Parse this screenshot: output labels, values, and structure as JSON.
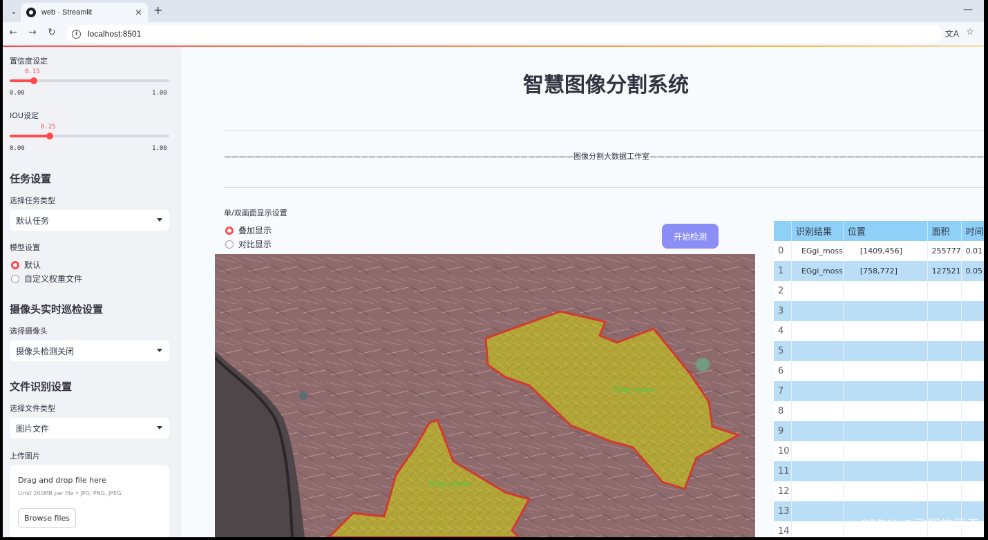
{
  "browser": {
    "tab_title": "web · Streamlit",
    "url": "localhost:8501"
  },
  "sidebar": {
    "confidence": {
      "label": "置信度设定",
      "value": "0.15",
      "value_fraction": 0.15,
      "min": "0.00",
      "max": "1.00"
    },
    "iou": {
      "label": "IOU设定",
      "value": "0.25",
      "value_fraction": 0.25,
      "min": "0.00",
      "max": "1.00"
    },
    "task_heading": "任务设置",
    "task_type_label": "选择任务类型",
    "task_type_value": "默认任务",
    "model_label": "模型设置",
    "model_options": [
      "默认",
      "自定义权重文件"
    ],
    "model_selected": "默认",
    "camera_heading": "摄像头实时巡检设置",
    "camera_label": "选择摄像头",
    "camera_value": "摄像头检测关闭",
    "file_heading": "文件识别设置",
    "file_type_label": "选择文件类型",
    "file_type_value": "图片文件",
    "upload_label": "上传图片",
    "dropzone_title": "Drag and drop file here",
    "dropzone_limit": "Limit 200MB per file • JPG, PNG, JPEG",
    "browse_label": "Browse files"
  },
  "main": {
    "title": "智慧图像分割系统",
    "studio_line": "——————————————————————————————————————————————图像分割大数据工作室——————————————————————————————————————————————————",
    "display_label": "单/双画面显示设置",
    "display_options": [
      "叠加显示",
      "对比显示"
    ],
    "display_selected": "叠加显示",
    "start_button": "开始检测",
    "mask_labels": [
      "EGgi_moss",
      "EGgi_moss"
    ]
  },
  "table": {
    "headers": [
      "",
      "识别结果",
      "位置",
      "面积",
      "时间"
    ],
    "rows": [
      {
        "idx": "0",
        "result": "EGgi_moss",
        "pos": "[1409,456]",
        "area": "255777",
        "time": "0.01"
      },
      {
        "idx": "1",
        "result": "EGgi_moss",
        "pos": "[758,772]",
        "area": "127521",
        "time": "0.05"
      },
      {
        "idx": "2",
        "result": "",
        "pos": "",
        "area": "",
        "time": ""
      },
      {
        "idx": "3",
        "result": "",
        "pos": "",
        "area": "",
        "time": ""
      },
      {
        "idx": "4",
        "result": "",
        "pos": "",
        "area": "",
        "time": ""
      },
      {
        "idx": "5",
        "result": "",
        "pos": "",
        "area": "",
        "time": ""
      },
      {
        "idx": "6",
        "result": "",
        "pos": "",
        "area": "",
        "time": ""
      },
      {
        "idx": "7",
        "result": "",
        "pos": "",
        "area": "",
        "time": ""
      },
      {
        "idx": "8",
        "result": "",
        "pos": "",
        "area": "",
        "time": ""
      },
      {
        "idx": "9",
        "result": "",
        "pos": "",
        "area": "",
        "time": ""
      },
      {
        "idx": "10",
        "result": "",
        "pos": "",
        "area": "",
        "time": ""
      },
      {
        "idx": "11",
        "result": "",
        "pos": "",
        "area": "",
        "time": ""
      },
      {
        "idx": "12",
        "result": "",
        "pos": "",
        "area": "",
        "time": ""
      },
      {
        "idx": "13",
        "result": "",
        "pos": "",
        "area": "",
        "time": ""
      },
      {
        "idx": "14",
        "result": "",
        "pos": "",
        "area": "",
        "time": ""
      }
    ]
  },
  "watermark": "CSDN @飞翔的佩奇",
  "colors": {
    "accent": "#ff4b4b",
    "button": "#8b8ef5",
    "table_header": "#8fd0f8",
    "mask": "#c8c83a",
    "mask_outline": "#d23a30"
  }
}
